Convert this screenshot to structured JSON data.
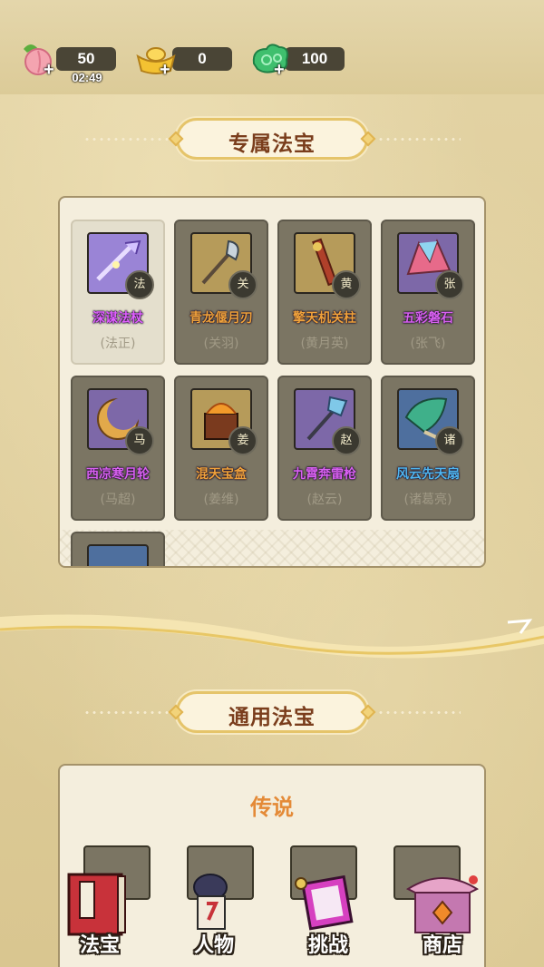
{
  "resources": [
    {
      "name": "peach-stamina",
      "value": "50",
      "timer": "02:49",
      "icon": "peach-icon"
    },
    {
      "name": "gold-ingot",
      "value": "0",
      "icon": "gold-ingot-icon"
    },
    {
      "name": "jade-cloud",
      "value": "100",
      "icon": "jade-cloud-icon"
    }
  ],
  "sections": {
    "exclusive": {
      "title": "专属法宝"
    },
    "general": {
      "title": "通用法宝",
      "tier": "传说"
    }
  },
  "exclusive_items": [
    {
      "name": "深谋法杖",
      "owner": "(法正)",
      "badge": "法",
      "name_color": "#e060ff",
      "icon_bg": "#9a84d6",
      "selected": true
    },
    {
      "name": "青龙偃月刃",
      "owner": "(关羽)",
      "badge": "关",
      "name_color": "#f0a23a",
      "icon_bg": "#b69b5a"
    },
    {
      "name": "擎天机关柱",
      "owner": "(黄月英)",
      "badge": "黄",
      "name_color": "#f0a23a",
      "icon_bg": "#b69b5a"
    },
    {
      "name": "五彩磐石",
      "owner": "(张飞)",
      "badge": "张",
      "name_color": "#d860f0",
      "icon_bg": "#7d68a8"
    },
    {
      "name": "西凉寒月轮",
      "owner": "(马超)",
      "badge": "马",
      "name_color": "#d860f0",
      "icon_bg": "#7d68a8"
    },
    {
      "name": "混天宝盒",
      "owner": "(姜维)",
      "badge": "姜",
      "name_color": "#f0a23a",
      "icon_bg": "#b69b5a"
    },
    {
      "name": "九霄奔雷枪",
      "owner": "(赵云)",
      "badge": "赵",
      "name_color": "#d860f0",
      "icon_bg": "#7d68a8"
    },
    {
      "name": "风云先天扇",
      "owner": "(诸葛亮)",
      "badge": "诸",
      "name_color": "#4fb6f0",
      "icon_bg": "#4e6f9e"
    }
  ],
  "nav": [
    {
      "label": "法宝",
      "icon": "scroll-book-icon"
    },
    {
      "label": "人物",
      "icon": "character-icon"
    },
    {
      "label": "挑战",
      "icon": "challenge-scroll-icon"
    },
    {
      "label": "商店",
      "icon": "shop-gate-icon"
    }
  ]
}
